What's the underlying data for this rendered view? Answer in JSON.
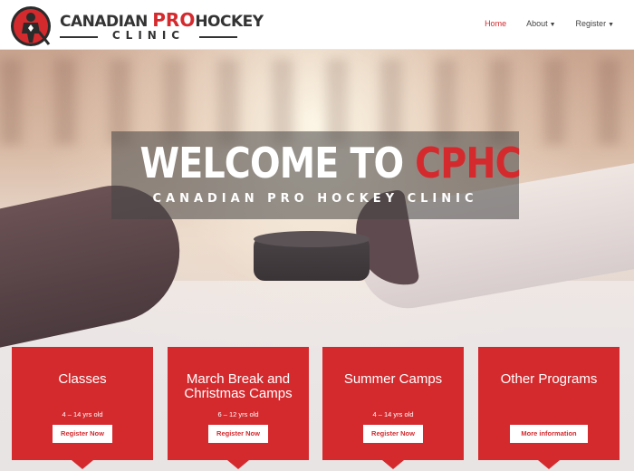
{
  "brand": {
    "name_part1": "CANADIAN ",
    "name_pro": "PRO",
    "name_part2": "HOCKEY",
    "name_sub": "CLINIC",
    "accent_color": "#d42a2e",
    "logo_icon": "hockey-player-badge-icon"
  },
  "nav": {
    "items": [
      {
        "label": "Home",
        "active": true
      },
      {
        "label": "About",
        "dropdown": true
      },
      {
        "label": "Register",
        "dropdown": true
      }
    ],
    "caret_icon": "caret-down-icon"
  },
  "hero": {
    "title_white": "WELCOME TO ",
    "title_red": "CPHC",
    "subtitle": "CANADIAN PRO HOCKEY CLINIC"
  },
  "cards": [
    {
      "title": "Classes",
      "age": "4 – 14 yrs old",
      "button": "Register Now"
    },
    {
      "title": "March Break and Christmas Camps",
      "age": "6 – 12 yrs old",
      "button": "Register Now"
    },
    {
      "title": "Summer Camps",
      "age": "4 – 14 yrs old",
      "button": "Register Now"
    },
    {
      "title": "Other Programs",
      "age": "",
      "button": "More information"
    }
  ]
}
